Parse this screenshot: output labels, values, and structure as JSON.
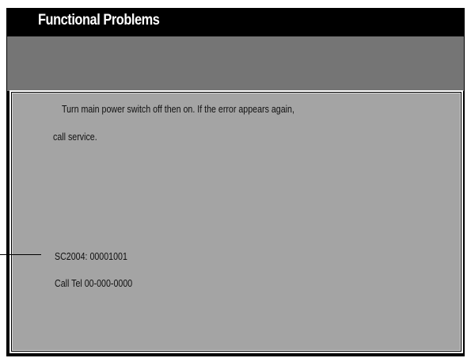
{
  "screen": {
    "title": "Functional Problems"
  },
  "message": {
    "line1": "Turn main power switch off then on. If the error appears again,",
    "line2": "call service.",
    "code": "SC2004: 00001001",
    "phone": "Call Tel 00-000-0000"
  },
  "colors": {
    "frame": "#000000",
    "band": "#757575",
    "message_bg": "#a4a4a4",
    "title_text": "#ffffff"
  }
}
